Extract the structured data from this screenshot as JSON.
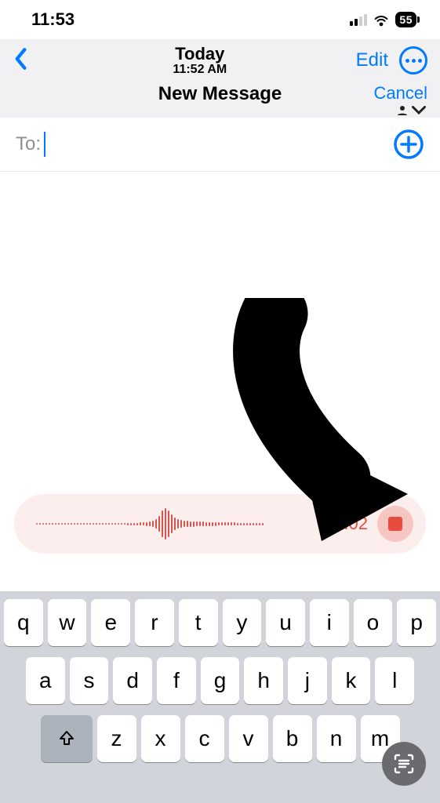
{
  "status": {
    "time": "11:53",
    "battery": "55"
  },
  "nav": {
    "title": "Today",
    "subtitle": "11:52 AM",
    "edit": "Edit"
  },
  "compose": {
    "title": "New Message",
    "cancel": "Cancel",
    "to_label": "To:",
    "to_value": ""
  },
  "recording": {
    "time": "0:02"
  },
  "keyboard": {
    "row1": [
      "q",
      "w",
      "e",
      "r",
      "t",
      "y",
      "u",
      "i",
      "o",
      "p"
    ],
    "row2": [
      "a",
      "s",
      "d",
      "f",
      "g",
      "h",
      "j",
      "k",
      "l"
    ],
    "row3": [
      "z",
      "x",
      "c",
      "v",
      "b",
      "n",
      "m"
    ]
  }
}
